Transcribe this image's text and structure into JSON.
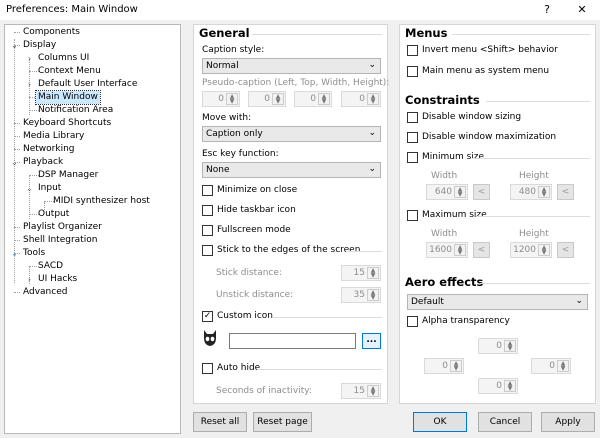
{
  "window": {
    "title": "Preferences: Main Window",
    "help": "?",
    "close": "✕"
  },
  "tree": [
    "Components",
    "Display",
    "Columns UI",
    "Context Menu",
    "Default User Interface",
    "Main Window",
    "Notification Area",
    "Keyboard Shortcuts",
    "Media Library",
    "Networking",
    "Playback",
    "DSP Manager",
    "Input",
    "MIDI synthesizer host",
    "Output",
    "Playlist Organizer",
    "Shell Integration",
    "Tools",
    "SACD",
    "UI Hacks",
    "Advanced"
  ],
  "general": {
    "heading": "General",
    "caption_style_label": "Caption style:",
    "caption_style": "Normal",
    "pseudo_label": "Pseudo-caption (Left, Top, Width, Height):",
    "pseudo": [
      "0",
      "0",
      "0",
      "0"
    ],
    "move_with_label": "Move with:",
    "move_with": "Caption only",
    "esc_label": "Esc key function:",
    "esc": "None",
    "minimize_on_close": "Minimize on close",
    "hide_taskbar": "Hide taskbar icon",
    "fullscreen": "Fullscreen mode",
    "stick": "Stick to the edges of the screen",
    "stick_distance_label": "Stick distance:",
    "stick_distance": "15",
    "unstick_distance_label": "Unstick distance:",
    "unstick_distance": "35",
    "custom_icon": "Custom icon",
    "browse": "...",
    "auto_hide": "Auto hide",
    "seconds_label": "Seconds of inactivity:",
    "seconds": "15"
  },
  "menus": {
    "heading": "Menus",
    "invert": "Invert menu <Shift> behavior",
    "system": "Main menu as system menu"
  },
  "constraints": {
    "heading": "Constraints",
    "disable_sizing": "Disable window sizing",
    "disable_max": "Disable window maximization",
    "min_size": "Minimum size",
    "max_size": "Maximum size",
    "width_label": "Width",
    "height_label": "Height",
    "min_width": "640",
    "min_height": "480",
    "max_width": "1600",
    "max_height": "1200",
    "pick": "<"
  },
  "aero": {
    "heading": "Aero effects",
    "mode": "Default",
    "alpha": "Alpha transparency",
    "m_top": "0",
    "m_left": "0",
    "m_right": "0",
    "m_bottom": "0"
  },
  "buttons": {
    "reset_all": "Reset all",
    "reset_page": "Reset page",
    "ok": "OK",
    "cancel": "Cancel",
    "apply": "Apply"
  }
}
